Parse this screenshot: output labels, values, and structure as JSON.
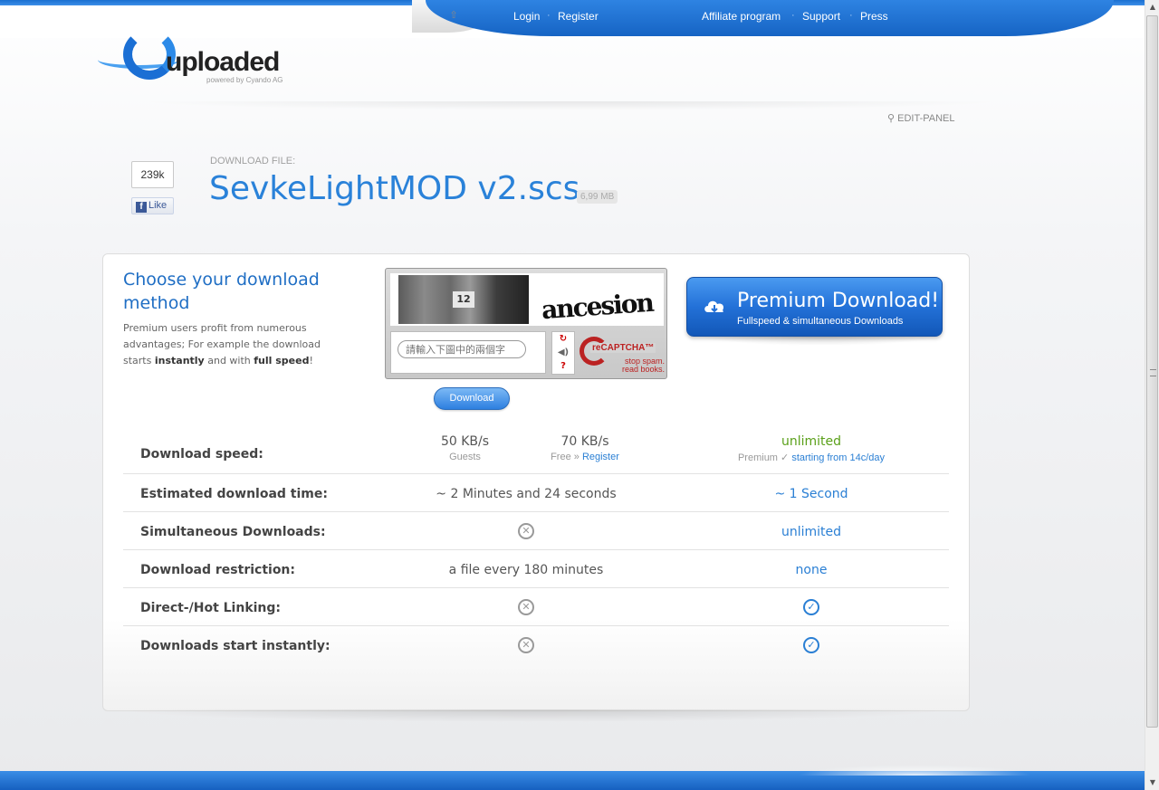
{
  "nav": {
    "login": "Login",
    "register": "Register",
    "affiliate": "Affiliate program",
    "support": "Support",
    "press": "Press",
    "sep": "·"
  },
  "logo": {
    "word": "uploaded",
    "powered": "powered by Cyando AG"
  },
  "edit_panel": "EDIT-PANEL",
  "social": {
    "like_count": "239k",
    "like_label": "Like"
  },
  "file": {
    "label": "DOWNLOAD FILE:",
    "name": "SevkeLightMOD v2.scs",
    "size": "6,99 MB"
  },
  "choose": {
    "title": "Choose your download method",
    "desc_start": "Premium users profit from numerous advantages; For example the download starts ",
    "desc_b1": "instantly",
    "desc_mid": " and with ",
    "desc_b2": "full speed",
    "desc_end": "!"
  },
  "captcha": {
    "plate_number": "12",
    "challenge_word": "ancesion",
    "input_placeholder": "請輸入下圖中的兩個字",
    "brand": "reCAPTCHA™",
    "tagline_1": "stop spam.",
    "tagline_2": "read books."
  },
  "download_button": "Download",
  "premium": {
    "title": "Premium Download!",
    "subtitle": "Fullspeed & simultaneous Downloads"
  },
  "comparison": {
    "speed": {
      "label": "Download speed:",
      "guest_value": "50 KB/s",
      "guest_sub": "Guests",
      "free_value": "70 KB/s",
      "free_sub": "Free »",
      "free_link": "Register",
      "premium_value": "unlimited",
      "premium_sub": "Premium ✓",
      "premium_link": "starting from 14c/day"
    },
    "time": {
      "label": "Estimated download time:",
      "free": "~ 2 Minutes and 24 seconds",
      "premium": "~ 1 Second"
    },
    "simultaneous": {
      "label": "Simultaneous Downloads:",
      "premium": "unlimited"
    },
    "restriction": {
      "label": "Download restriction:",
      "free": "a file every 180 minutes",
      "premium": "none"
    },
    "hotlink": {
      "label": "Direct-/Hot Linking:"
    },
    "instant": {
      "label": "Downloads start instantly:"
    }
  },
  "colors": {
    "brand_blue": "#2a82d9",
    "premium_button": "#2371d8",
    "unlimited_green": "#5aa019"
  }
}
